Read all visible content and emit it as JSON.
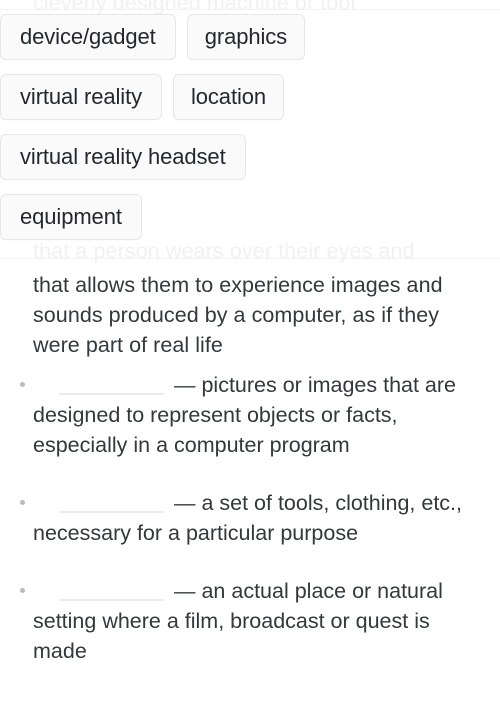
{
  "ghost_text": {
    "top_line": "cleverly designed machine or tool",
    "middle_line": "that a person wears over their eyes and"
  },
  "word_bank": {
    "rows": [
      [
        {
          "label": "device/gadget"
        },
        {
          "label": "graphics"
        }
      ],
      [
        {
          "label": "virtual reality"
        },
        {
          "label": "location"
        }
      ],
      [
        {
          "label": "virtual reality headset"
        }
      ],
      [
        {
          "label": "equipment"
        }
      ]
    ]
  },
  "definition_intro": "that allows them to experience images and sounds produced by a computer, as if they were part of real life",
  "definitions": [
    {
      "blank": "",
      "text": "— pictures or images that are designed to represent objects or facts, especially in a computer program"
    },
    {
      "blank": "",
      "text": "— a set of tools, clothing, etc., necessary for a particular purpose"
    },
    {
      "blank": "",
      "text": "— an actual place or natural setting where a film, broadcast or quest is made"
    }
  ],
  "colors": {
    "chip_background": "#fafafa",
    "chip_border": "#e6e7e9",
    "text": "#33383d",
    "ghost_text": "#f0f1f3",
    "blank_rule": "#ececec",
    "bullet": "#b9bcc0"
  }
}
